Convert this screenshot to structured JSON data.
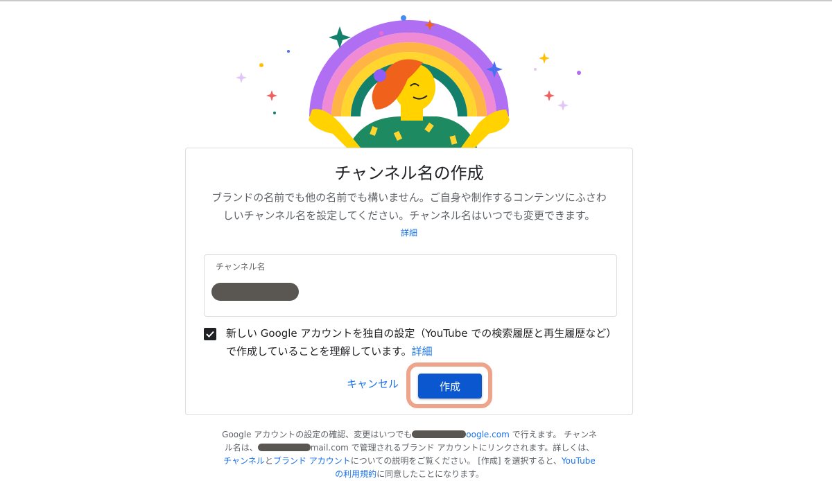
{
  "card": {
    "title": "チャンネル名の作成",
    "description": "ブランドの名前でも他の名前でも構いません。ご自身や制作するコンテンツにふさわしいチャンネル名を設定してください。チャンネル名はいつでも変更できます。",
    "learn_more": "詳細"
  },
  "name_field": {
    "label": "チャンネル名",
    "value": ""
  },
  "consent": {
    "checked": true,
    "text": "新しい Google アカウントを独自の設定（YouTube での検索履歴と再生履歴など）で作成していることを理解しています。",
    "link": "詳細"
  },
  "actions": {
    "cancel": "キャンセル",
    "create": "作成"
  },
  "footer": {
    "p1": "Google アカウントの設定の確認、変更はいつでも",
    "p1_link": "oogle.com",
    "p2": " で行えます。 チャンネル名は、",
    "p3": "mail.com で管理されるブランド アカウントにリンクされます。詳しくは、",
    "link_channel": "チャンネル",
    "p4": "と",
    "link_brand": "ブランド アカウント",
    "p5": "についての説明をご覧ください。 [作成] を選択すると、",
    "link_terms": "YouTube の利用規約",
    "p6": "に同意したことになります。"
  },
  "colors": {
    "accent": "#0b57d0",
    "link": "#1a73e8",
    "highlight": "#eea48a"
  }
}
